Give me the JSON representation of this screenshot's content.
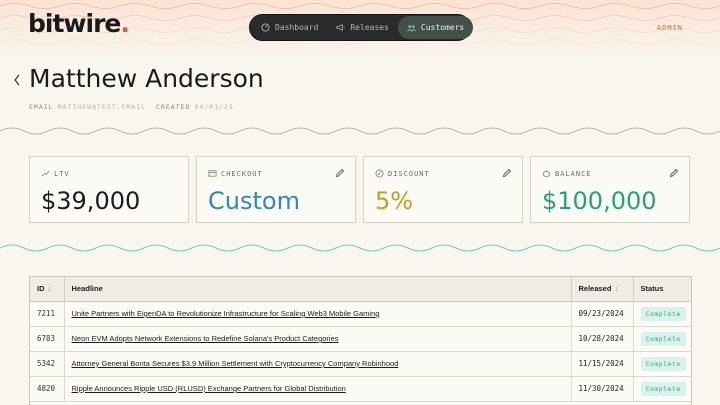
{
  "brand": {
    "name": "bitwire",
    "dot": "."
  },
  "nav": {
    "items": [
      {
        "label": "Dashboard",
        "icon": "gauge-icon"
      },
      {
        "label": "Releases",
        "icon": "megaphone-icon"
      },
      {
        "label": "Customers",
        "icon": "users-icon",
        "active": true
      }
    ]
  },
  "header": {
    "admin_label": "ADMIN"
  },
  "customer": {
    "name": "Matthew Anderson",
    "email_label": "EMAIL",
    "email_value": "MATTHEW@TEST.EMAIL",
    "created_label": "CREATED",
    "created_value": "04/01/25"
  },
  "stats": [
    {
      "label": "LTV",
      "value": "$39,000",
      "color": "#1c1c1c",
      "icon": "trend-icon",
      "editable": false
    },
    {
      "label": "CHECKOUT",
      "value": "Custom",
      "color": "#2a8bb5",
      "icon": "checkout-icon",
      "editable": true
    },
    {
      "label": "DISCOUNT",
      "value": "5%",
      "color": "#c99a1b",
      "icon": "discount-icon",
      "editable": true
    },
    {
      "label": "BALANCE",
      "value": "$100,000",
      "color": "#22a27c",
      "icon": "piggy-bank-icon",
      "editable": true
    }
  ],
  "table": {
    "columns": [
      {
        "label": "ID",
        "sort": "↓",
        "sort_color": "#e8692f"
      },
      {
        "label": "Headline"
      },
      {
        "label": "Released",
        "sort": "↓",
        "sort_color": "#9a9890"
      },
      {
        "label": "Status"
      }
    ],
    "rows": [
      {
        "id": "7211",
        "headline": "Unite Partners with EigenDA to Revolutionize Infrastructure for Scaling Web3 Mobile Gaming",
        "released": "09/23/2024",
        "status": "Complete"
      },
      {
        "id": "6783",
        "headline": "Neon EVM Adopts Network Extensions to Redefine Solana's Product Categories",
        "released": "10/28/2024",
        "status": "Complete"
      },
      {
        "id": "5342",
        "headline": "Attorney General Bonta Secures $3.9 Million Settlement with Cryptocurrency Company Robinhood",
        "released": "11/15/2024",
        "status": "Complete"
      },
      {
        "id": "4820",
        "headline": "Ripple Announces Ripple USD (RLUSD) Exchange Partners for Global Distribution",
        "released": "11/30/2024",
        "status": "Complete"
      }
    ]
  }
}
